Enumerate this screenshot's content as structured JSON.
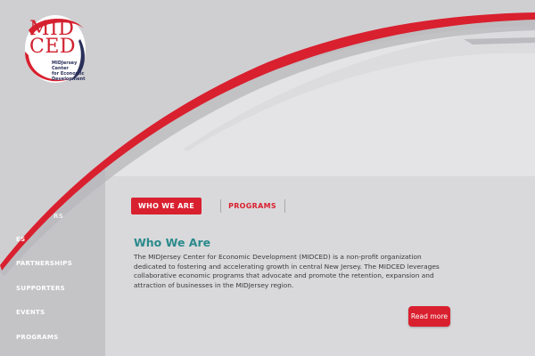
{
  "logo": {
    "line1": "MID",
    "line2": "CED",
    "subtitle": [
      "MIDJersey Center",
      "for Economic",
      "Development"
    ]
  },
  "sidebar": {
    "items": [
      {
        "label": "RS"
      },
      {
        "label": "ES"
      },
      {
        "label": "PARTNERSHIPS"
      },
      {
        "label": "SUPPORTERS"
      },
      {
        "label": "EVENTS"
      },
      {
        "label": "PROGRAMS"
      }
    ]
  },
  "tabs": [
    {
      "label": "WHO WE ARE",
      "active": true
    },
    {
      "label": "PROGRAMS",
      "active": false
    }
  ],
  "content": {
    "heading": "Who We Are",
    "paragraph": "The MIDJersey Center for Economic Development (MIDCED) is a non-profit organization dedicated to fostering and accelerating growth in central New Jersey. The MIDCED leverages collaborative economic programs that advocate and promote the retention, expansion and attraction of businesses in the MIDJersey region.",
    "read_more_label": "Read more"
  },
  "colors": {
    "brand_red": "#d9202f",
    "heading_teal": "#2a8a8c",
    "logo_navy": "#2a2f5a"
  }
}
